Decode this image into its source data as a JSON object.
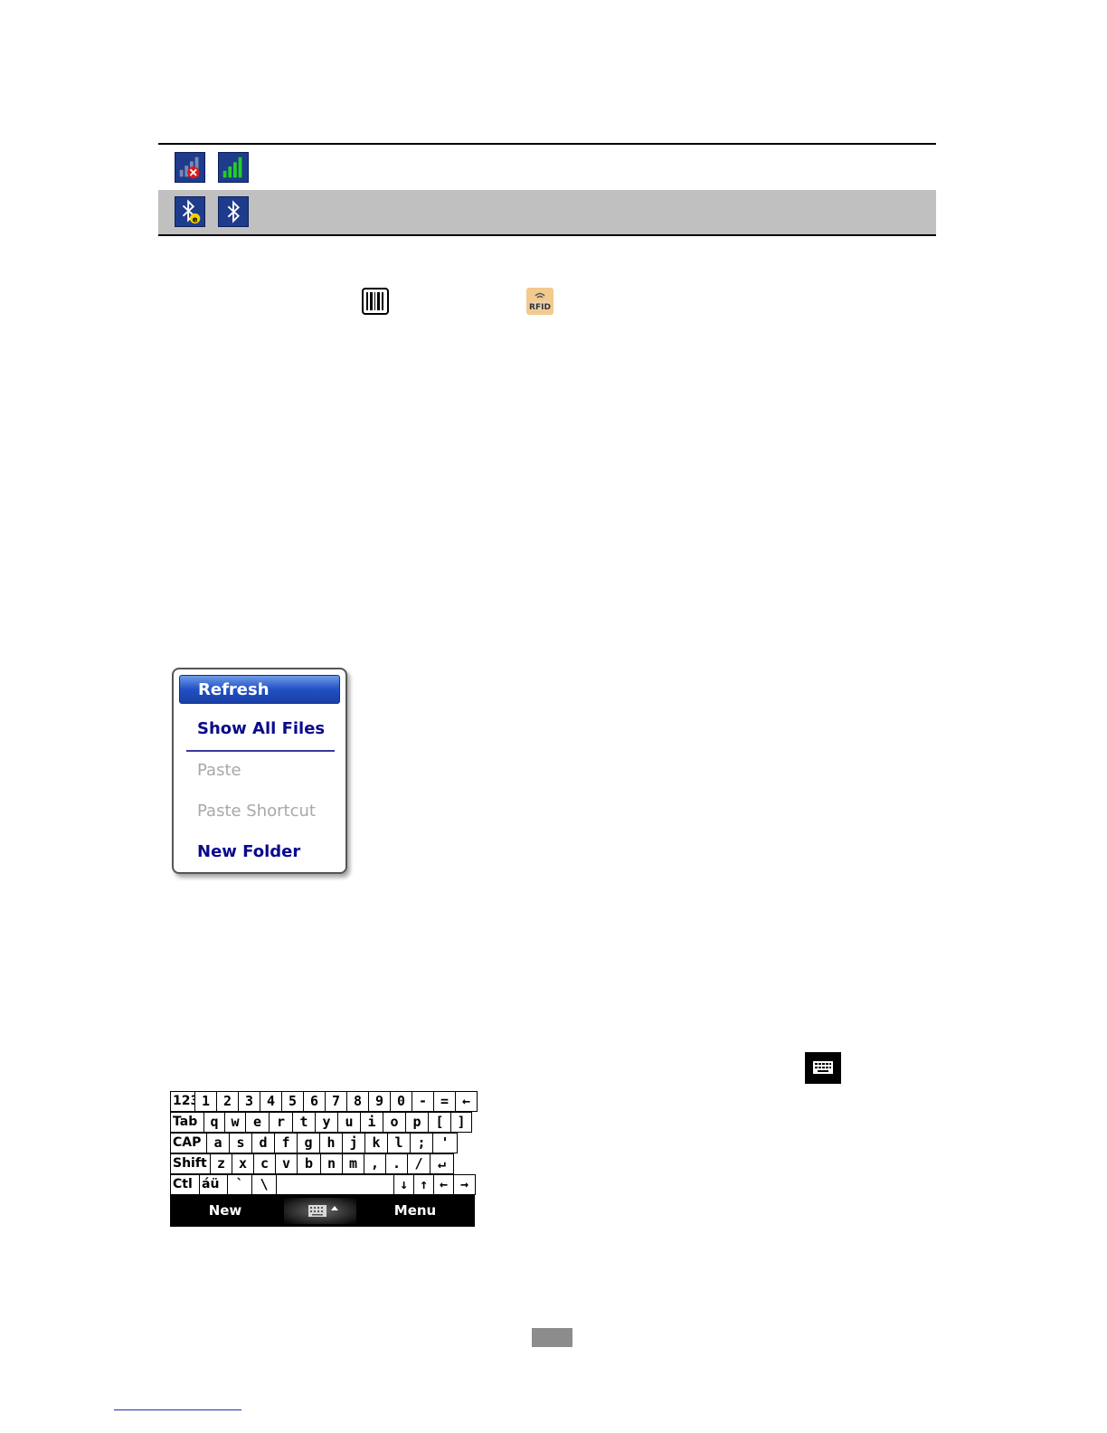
{
  "status_icons": {
    "row1": [
      "no-signal-icon",
      "signal-strength-icon"
    ],
    "row2": [
      "bluetooth-discoverable-icon",
      "bluetooth-on-icon"
    ]
  },
  "inline_icons": [
    "barcode-scanner-icon",
    "rfid-icon"
  ],
  "context_menu": {
    "items": [
      {
        "label": "Refresh",
        "state": "active"
      },
      {
        "label": "Show All Files",
        "state": "enabled"
      },
      {
        "label": "Paste",
        "state": "disabled"
      },
      {
        "label": "Paste Shortcut",
        "state": "disabled"
      },
      {
        "label": "New Folder",
        "state": "enabled"
      }
    ]
  },
  "keyboard": {
    "rows": [
      [
        "123",
        "1",
        "2",
        "3",
        "4",
        "5",
        "6",
        "7",
        "8",
        "9",
        "0",
        "-",
        "=",
        "←"
      ],
      [
        "Tab",
        "q",
        "w",
        "e",
        "r",
        "t",
        "y",
        "u",
        "i",
        "o",
        "p",
        "[",
        "]"
      ],
      [
        "CAP",
        "a",
        "s",
        "d",
        "f",
        "g",
        "h",
        "j",
        "k",
        "l",
        ";",
        "'"
      ],
      [
        "Shift",
        "z",
        "x",
        "c",
        "v",
        "b",
        "n",
        "m",
        ",",
        ".",
        "/",
        "↵"
      ],
      [
        "Ctl",
        "áü",
        "`",
        "\\",
        " ",
        "↓",
        "↑",
        "←",
        "→"
      ]
    ],
    "softkeys": {
      "left": "New",
      "right": "Menu"
    }
  },
  "colors": {
    "status_icon_bg": "#1f3b8c",
    "menu_active": "#2151c4",
    "menu_text": "#0a0a8c"
  }
}
